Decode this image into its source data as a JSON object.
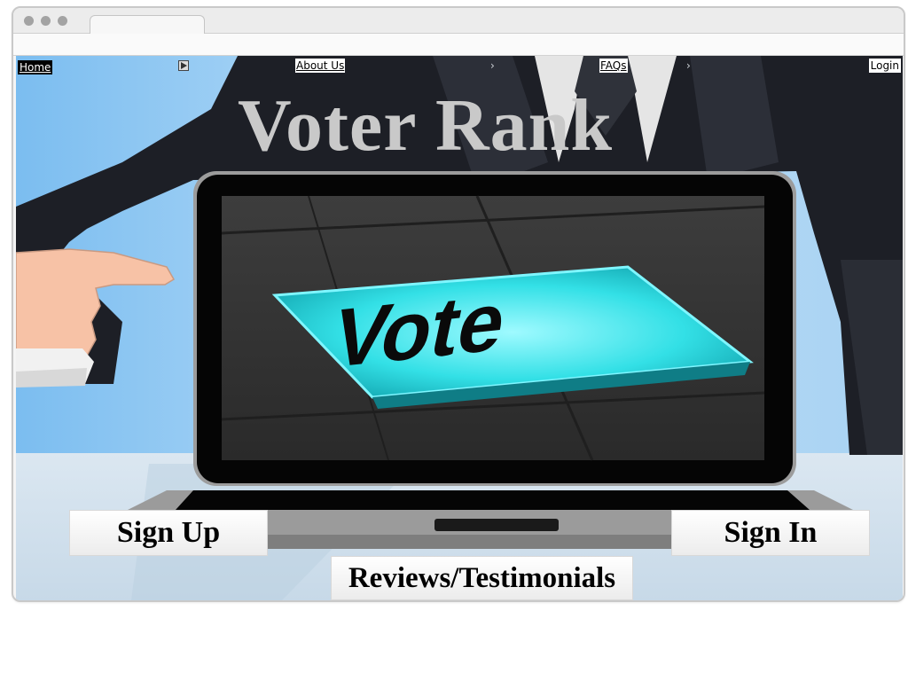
{
  "nav": {
    "home": "Home",
    "about": "About Us",
    "faqs": "FAQs",
    "login": "Login"
  },
  "title": "Voter Rank",
  "hero": {
    "screen_text": "Vote"
  },
  "buttons": {
    "signup": "Sign Up",
    "signin": "Sign In",
    "reviews": "Reviews/Testimonials"
  },
  "colors": {
    "sky": "#a9d4f3",
    "suit": "#1c1e24",
    "vote_key": "#3fe6e6",
    "title": "#c9c9c9"
  }
}
